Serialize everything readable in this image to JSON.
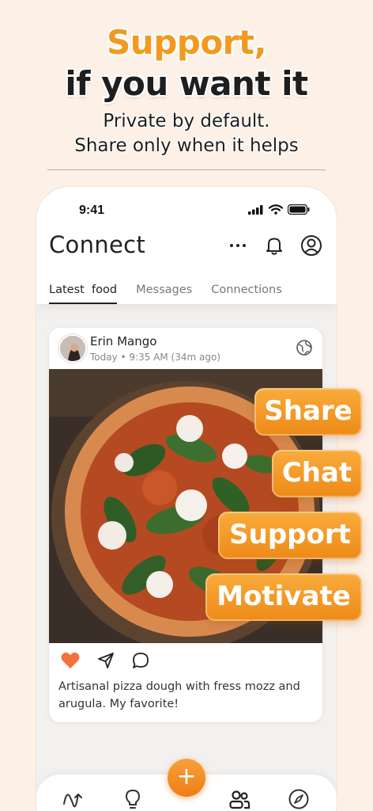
{
  "headline": {
    "line1": "Support,",
    "line2": "if you want it",
    "sub1": "Private by default.",
    "sub2": "Share only when it helps"
  },
  "status_bar": {
    "time": "9:41"
  },
  "app": {
    "title": "Connect",
    "tabs": [
      {
        "label": "Latest  food",
        "active": true
      },
      {
        "label": "Messages",
        "active": false
      },
      {
        "label": "Connections",
        "active": false
      }
    ]
  },
  "post": {
    "author": "Erin Mango",
    "meta": "Today • 9:35 AM (34m ago)",
    "caption": "Artisanal pizza dough with fress mozz and arugula. My favorite!"
  },
  "features": [
    "Share",
    "Chat",
    "Support",
    "Motivate"
  ],
  "colors": {
    "accent": "#ef8a1a",
    "like": "#f0723c"
  },
  "icons": [
    "more-icon",
    "bell-icon",
    "profile-icon",
    "globe-icon",
    "heart-icon",
    "send-icon",
    "comment-icon",
    "plus-icon",
    "activity-icon",
    "lightbulb-icon",
    "people-icon",
    "compass-icon"
  ]
}
